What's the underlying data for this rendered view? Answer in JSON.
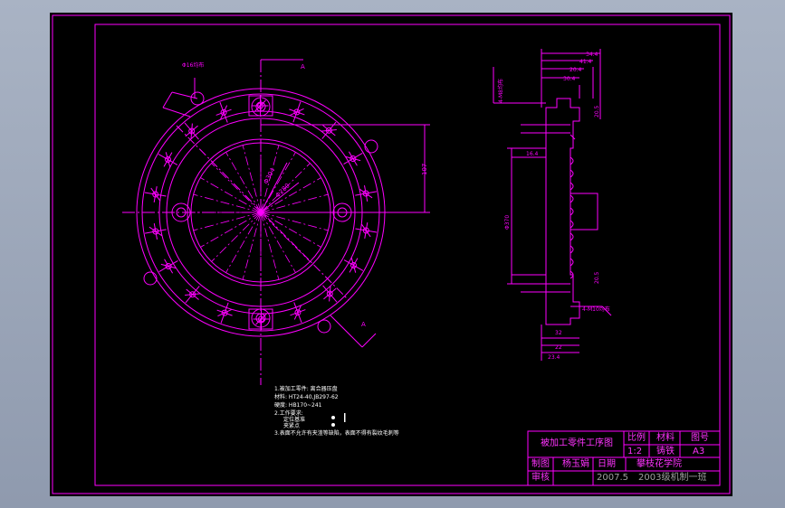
{
  "colors": {
    "line": "#ff00ff",
    "white": "#ffffff",
    "gray": "#9a9a9a",
    "background": "#000000"
  },
  "drawing": {
    "section_marks": [
      "A",
      "A"
    ],
    "front_dims": [
      "107",
      "Φ280",
      "Φ304"
    ],
    "side_dims": [
      "34.4",
      "41.4",
      "20.4",
      "30.4",
      "20.5",
      "16.4",
      "20.5",
      "32",
      "22",
      "23.4",
      "Φ370"
    ],
    "callout_top": "4-M8均布",
    "callout_bottom": "4-M10均布",
    "callout_left": "Φ16均布"
  },
  "notes": [
    "1.被加工零件: 离合器压盘",
    "  材料: HT24-40,JB297-62",
    "  硬度: HB170~241",
    "2.工作要求:",
    "  定位基准",
    "  夹紧点",
    "3.表面不允许有夹渣等缺陷，表面不得有裂纹毛刺等"
  ],
  "title_block": {
    "title": "被加工零件工序图",
    "scale_label": "比例",
    "scale": "1:2",
    "material_label": "材料",
    "material": "铸铁",
    "drawing_no_label": "图号",
    "drawing_no": "A3",
    "drawn_label": "制图",
    "drawer": "杨玉娟",
    "date_label": "日期",
    "date": "2007.5",
    "check_label": "审核",
    "school": "攀枝花学院",
    "class": "2003级机制一班"
  }
}
